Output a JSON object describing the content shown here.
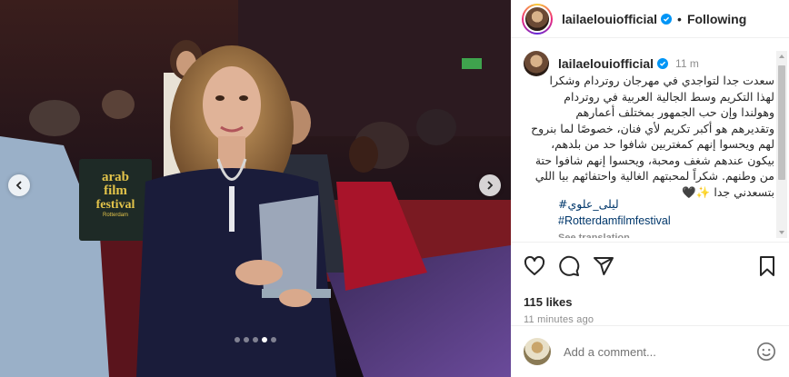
{
  "post": {
    "username": "lailaelouiofficial",
    "follow_status": "Following",
    "separator": "•",
    "time_ago": "11 m",
    "caption": "سعدت جدا لتواجدي في مهرجان روتردام وشكرا لهذا التكريم وسط الجالية العربية في روتردام وهولندا وإن حب الجمهور بمختلف أعمارهم وتقديرهم هو أكبر تكريم لأي فنان، خصوصًا لما بنروح لهم ويحسوا إنهم كمغتربين شافوا حد من بلدهم، بيكون عندهم شغف ومحبة، ويحسوا إنهم شافوا حتة من وطنهم. شكراً لمحبتهم الغالية واحتفائهم بيا اللي بتسعدني جدا ✨🖤",
    "hashtags": [
      "#ليلى_علوي",
      "#Rotterdamfilmfestival"
    ],
    "see_translation": "See translation",
    "likes": "115 likes",
    "posted_ago": "11 minutes ago",
    "comment_placeholder": "Add a comment..."
  },
  "media": {
    "slides_total": 5,
    "active_slide": 4,
    "festival_sign": [
      "arab",
      "film",
      "festival",
      "Rotterdam"
    ]
  },
  "icons": {
    "verified": "verified-badge-icon",
    "like": "heart-icon",
    "comment": "comment-bubble-icon",
    "share": "paper-plane-icon",
    "save": "bookmark-icon",
    "emoji": "smiley-icon",
    "prev": "chevron-left-icon",
    "next": "chevron-right-icon"
  },
  "colors": {
    "verified_blue": "#0095f6",
    "hashtag_blue": "#00376b",
    "muted_text": "#8e8e8e",
    "festival_gold": "#e2c34a"
  }
}
